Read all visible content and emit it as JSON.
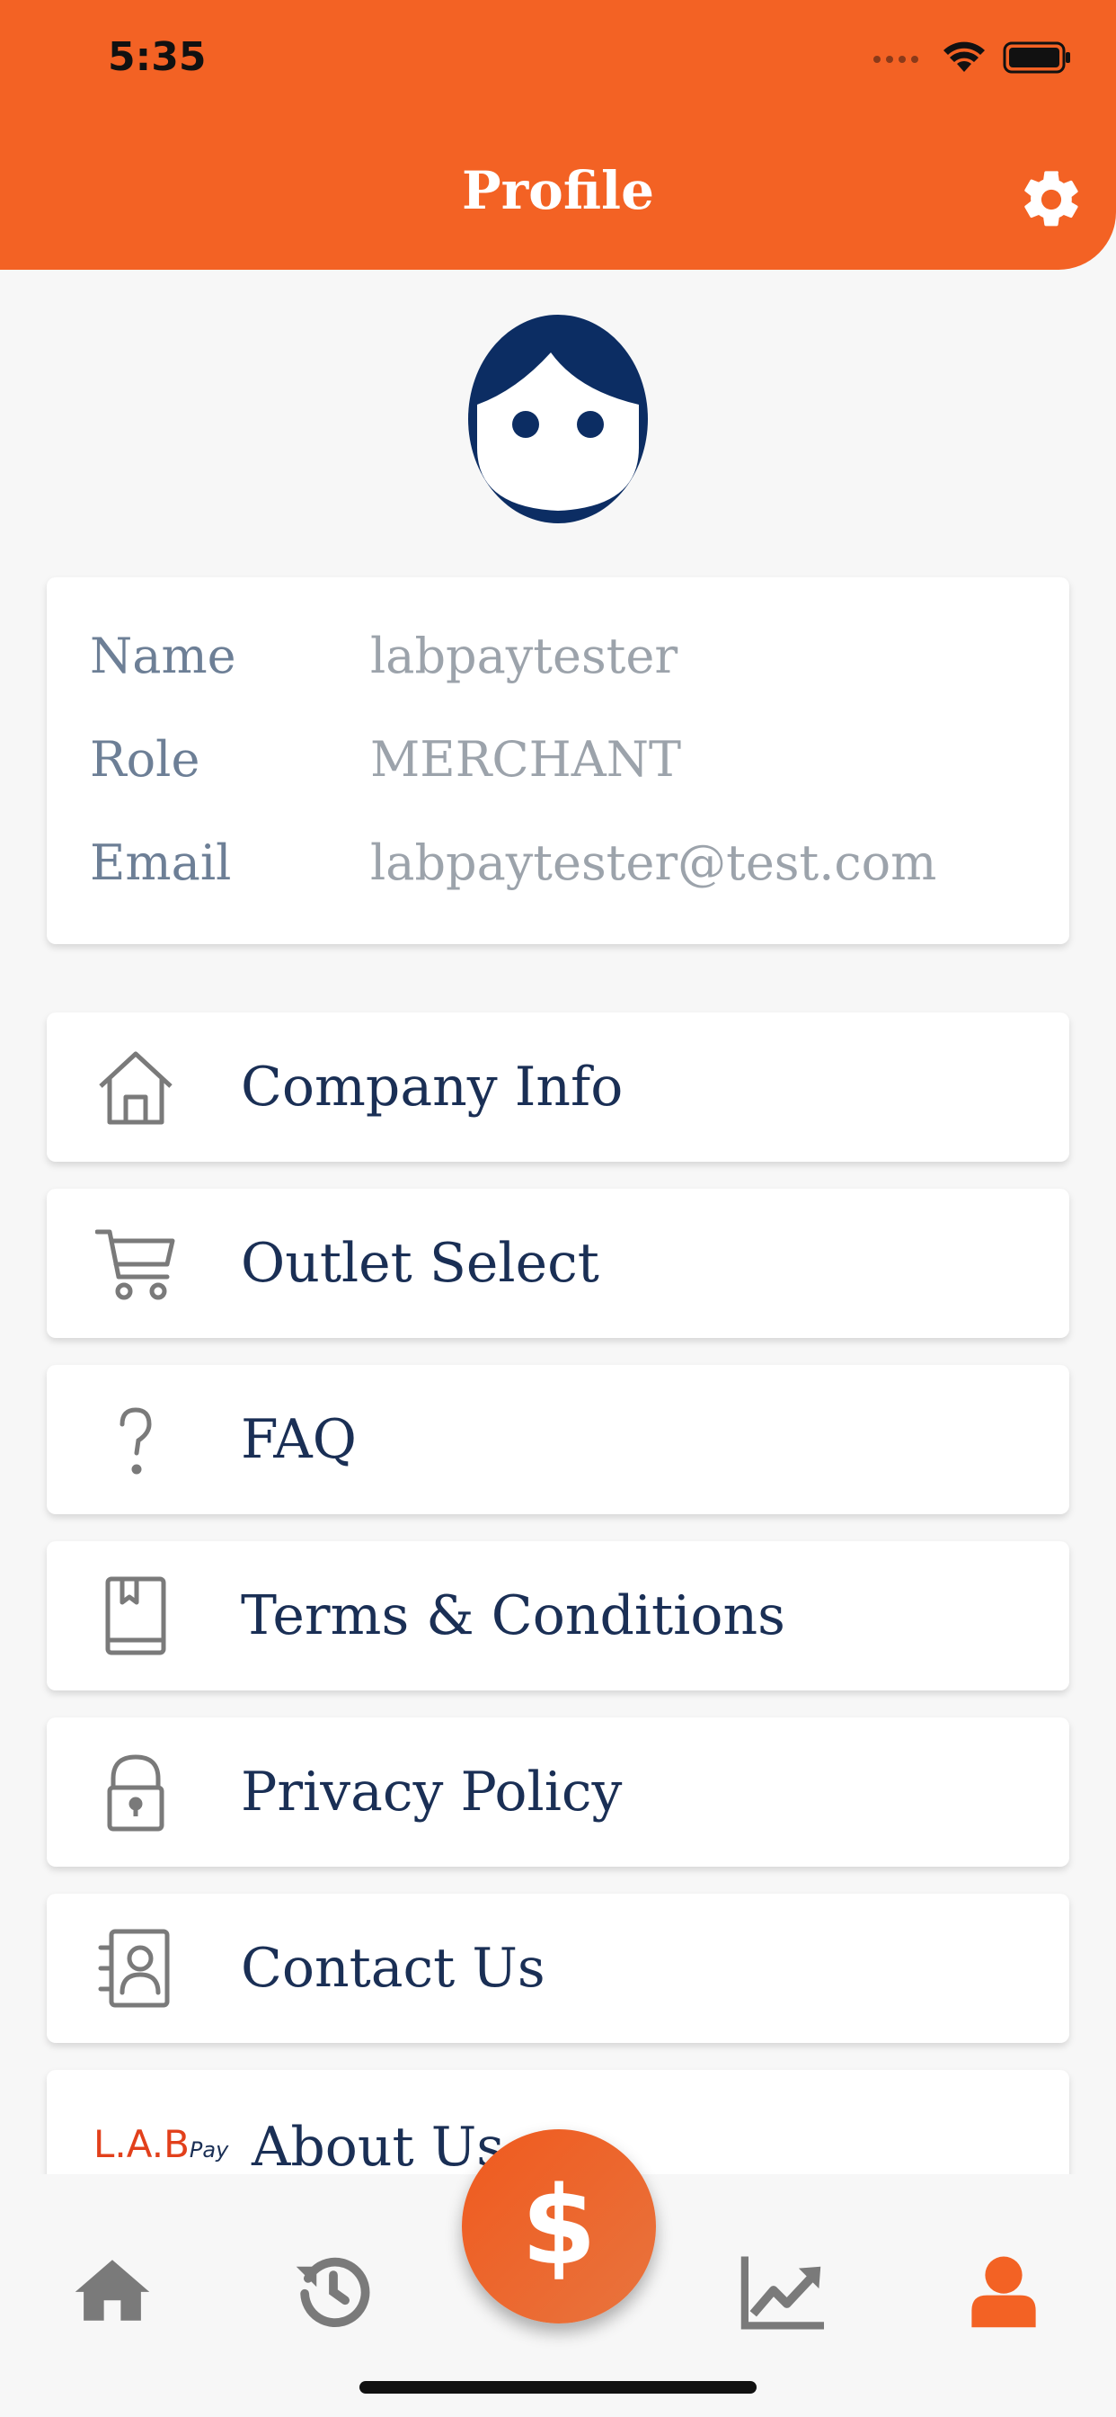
{
  "status_bar": {
    "time": "5:35"
  },
  "header": {
    "title": "Profile"
  },
  "profile": {
    "rows": [
      {
        "label": "Name",
        "value": "labpaytester"
      },
      {
        "label": "Role",
        "value": "MERCHANT"
      },
      {
        "label": "Email",
        "value": "labpaytester@test.com"
      }
    ]
  },
  "menu": {
    "items": [
      {
        "label": "Company Info",
        "icon": "house-icon"
      },
      {
        "label": "Outlet Select",
        "icon": "cart-icon"
      },
      {
        "label": "FAQ",
        "icon": "question-icon"
      },
      {
        "label": "Terms & Conditions",
        "icon": "book-icon"
      },
      {
        "label": "Privacy Policy",
        "icon": "lock-icon"
      },
      {
        "label": "Contact Us",
        "icon": "contact-card-icon"
      },
      {
        "label": "About Us",
        "icon": "labpay-logo"
      }
    ],
    "logo": {
      "main": "L.A.B",
      "sub": "Pay"
    }
  },
  "tabbar": {
    "pay_symbol": "$",
    "tabs": [
      "home-icon",
      "history-icon",
      "chart-icon",
      "profile-icon"
    ],
    "active_color": "#f36224",
    "inactive_color": "#7a7a7a"
  },
  "colors": {
    "brand": "#f36224",
    "navy": "#1a2f55"
  }
}
